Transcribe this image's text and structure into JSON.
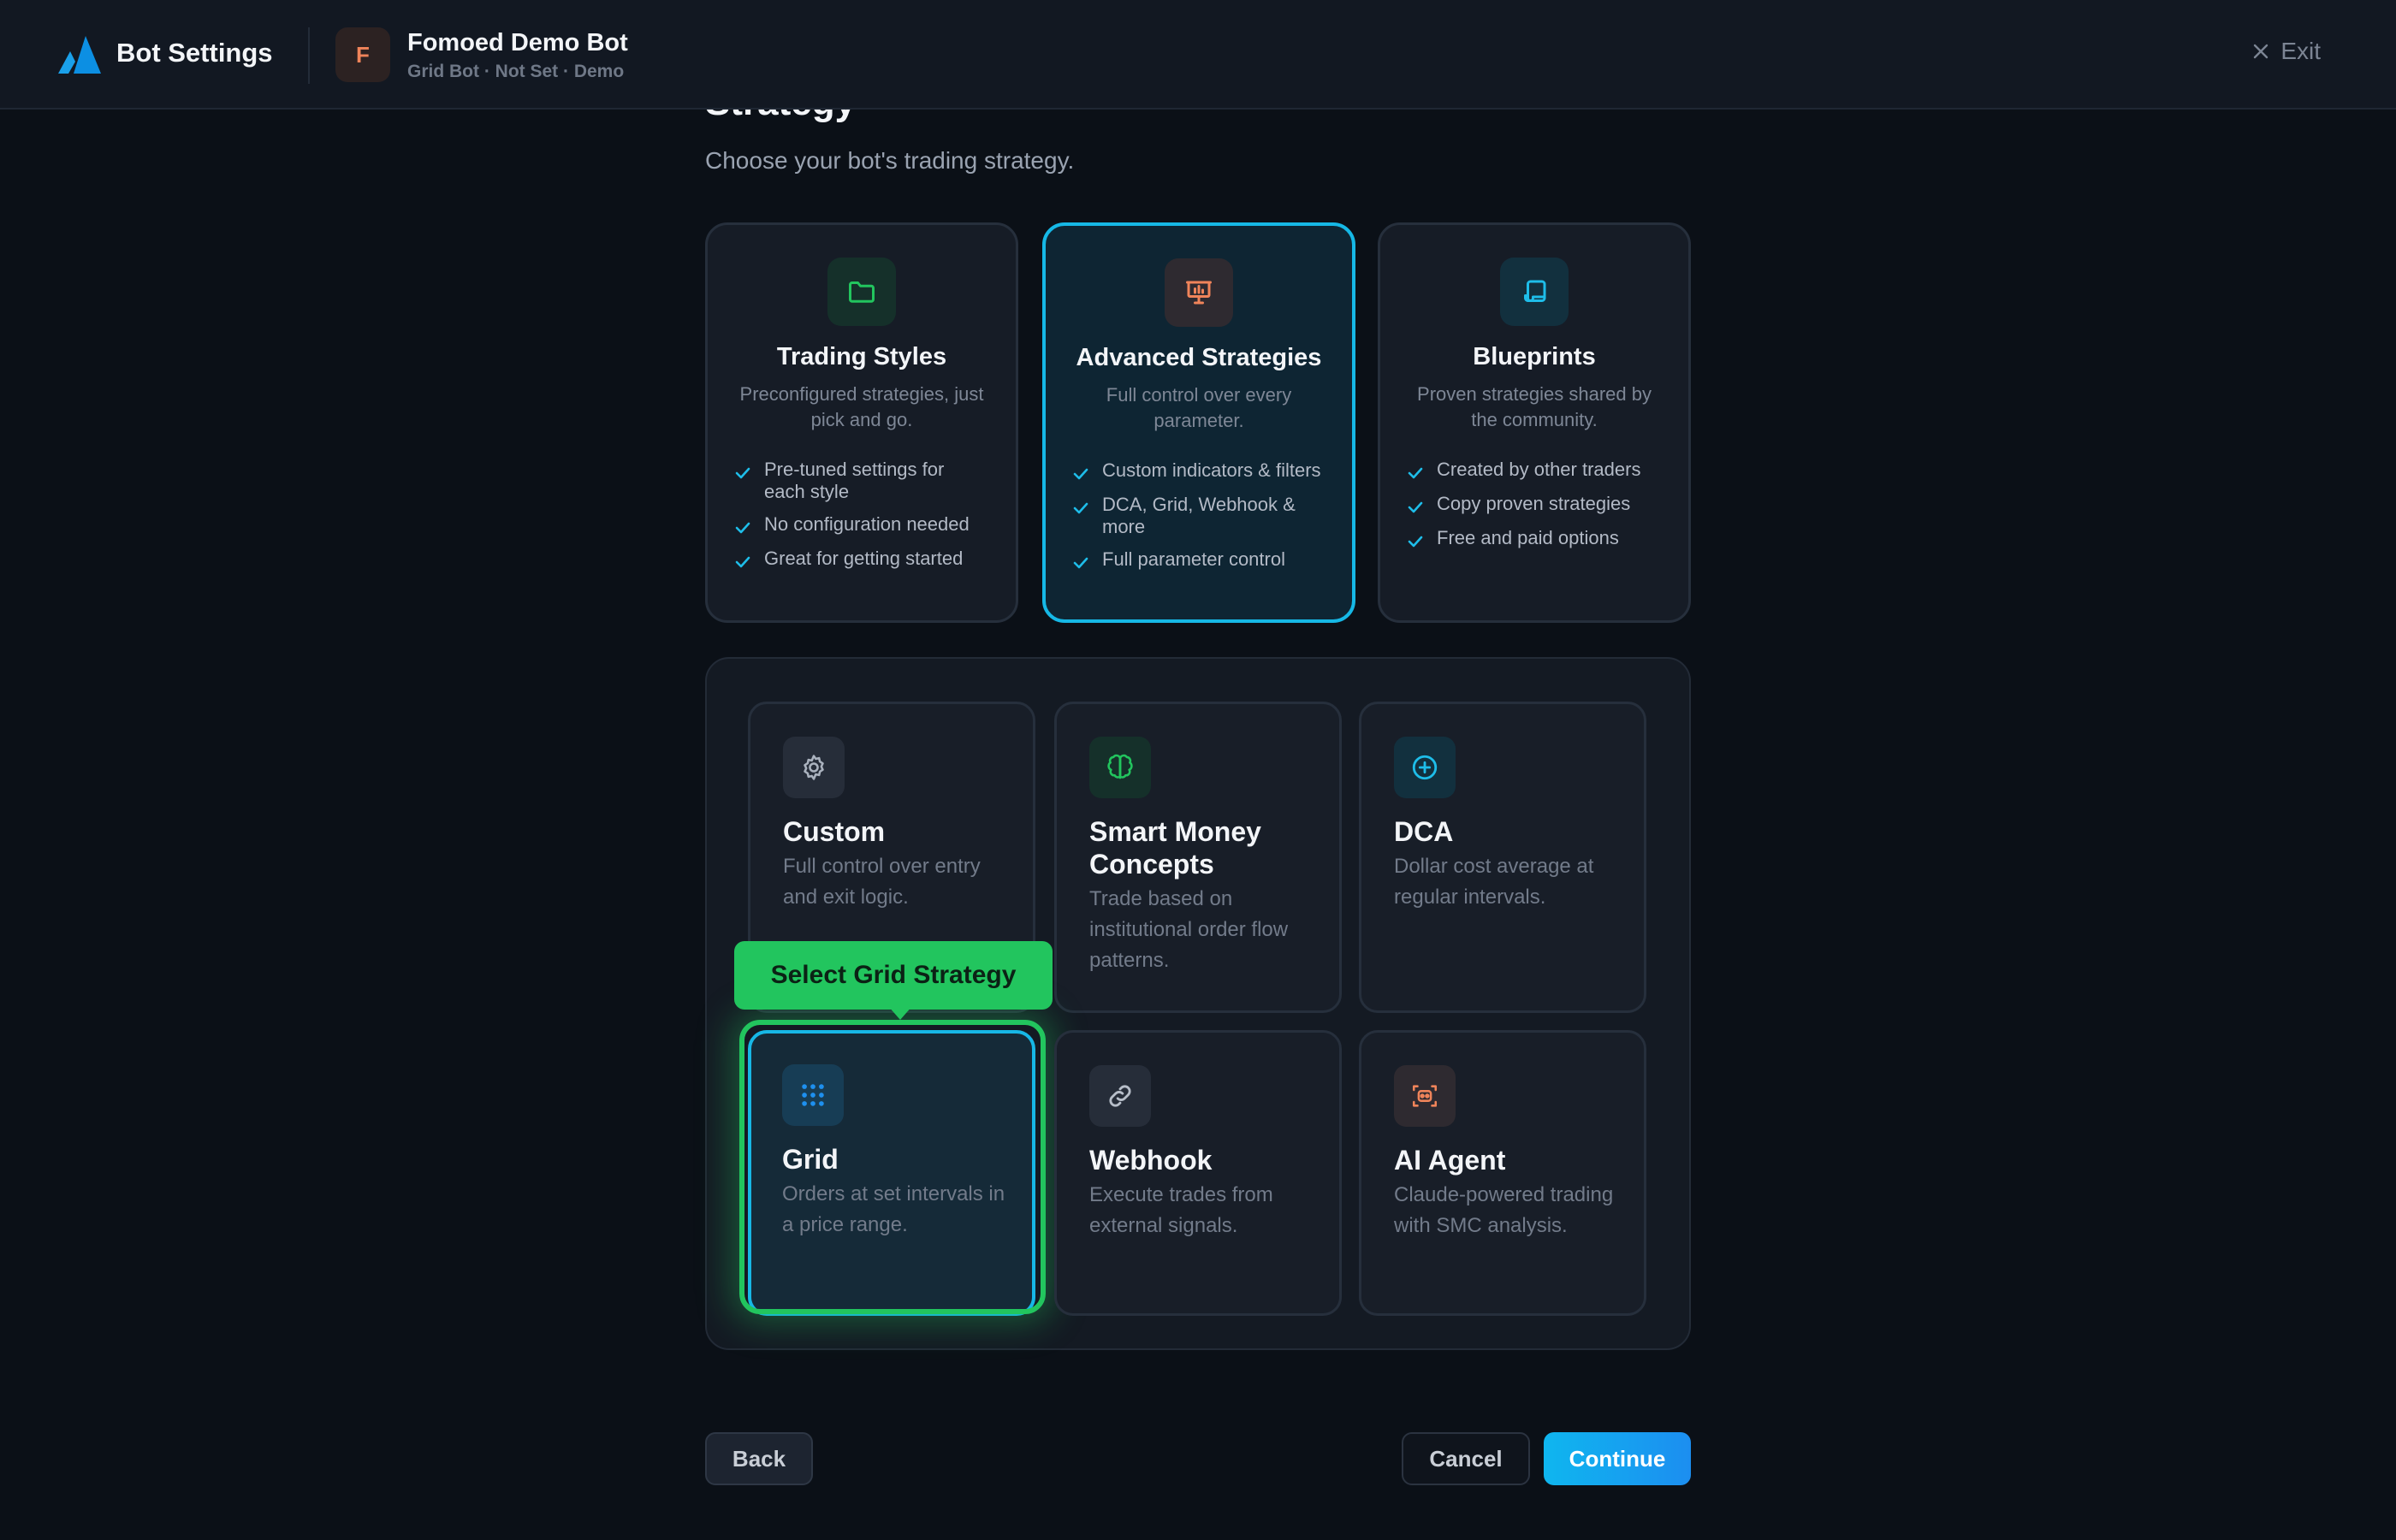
{
  "header": {
    "app_title": "Bot Settings",
    "bot_avatar_letter": "F",
    "bot_name": "Fomoed Demo Bot",
    "bot_subtitle": "Grid Bot · Not Set · Demo",
    "exit_label": "Exit"
  },
  "heading": {
    "title": "Strategy",
    "subtitle": "Choose your bot's trading strategy."
  },
  "modes": [
    {
      "title": "Trading Styles",
      "description": "Preconfigured strategies, just pick and go.",
      "icon": "folder-icon",
      "selected": false,
      "features": [
        "Pre-tuned settings for each style",
        "No configuration needed",
        "Great for getting started"
      ]
    },
    {
      "title": "Advanced Strategies",
      "description": "Full control over every parameter.",
      "icon": "presentation-icon",
      "selected": true,
      "features": [
        "Custom indicators & filters",
        "DCA, Grid, Webhook & more",
        "Full parameter control"
      ]
    },
    {
      "title": "Blueprints",
      "description": "Proven strategies shared by the community.",
      "icon": "scroll-icon",
      "selected": false,
      "features": [
        "Created by other traders",
        "Copy proven strategies",
        "Free and paid options"
      ]
    }
  ],
  "strategies": [
    {
      "title": "Custom",
      "description": "Full control over entry and exit logic.",
      "icon": "gear-icon"
    },
    {
      "title": "Smart Money Concepts",
      "description": "Trade based on institutional order flow patterns.",
      "icon": "brain-icon"
    },
    {
      "title": "DCA",
      "description": "Dollar cost average at regular intervals.",
      "icon": "plus-circle-icon"
    },
    {
      "title": "Grid",
      "description": "Orders at set intervals in a price range.",
      "icon": "grid-dots-icon",
      "selected": true
    },
    {
      "title": "Webhook",
      "description": "Execute trades from external signals.",
      "icon": "link-icon"
    },
    {
      "title": "AI Agent",
      "description": "Claude-powered trading with SMC analysis.",
      "icon": "bot-icon"
    }
  ],
  "callout": {
    "label": "Select Grid Strategy"
  },
  "footer": {
    "back_label": "Back",
    "cancel_label": "Cancel",
    "continue_label": "Continue"
  },
  "colors": {
    "accent": "#16b8e6",
    "highlight_green": "#22c55e",
    "background": "#0b1017"
  }
}
